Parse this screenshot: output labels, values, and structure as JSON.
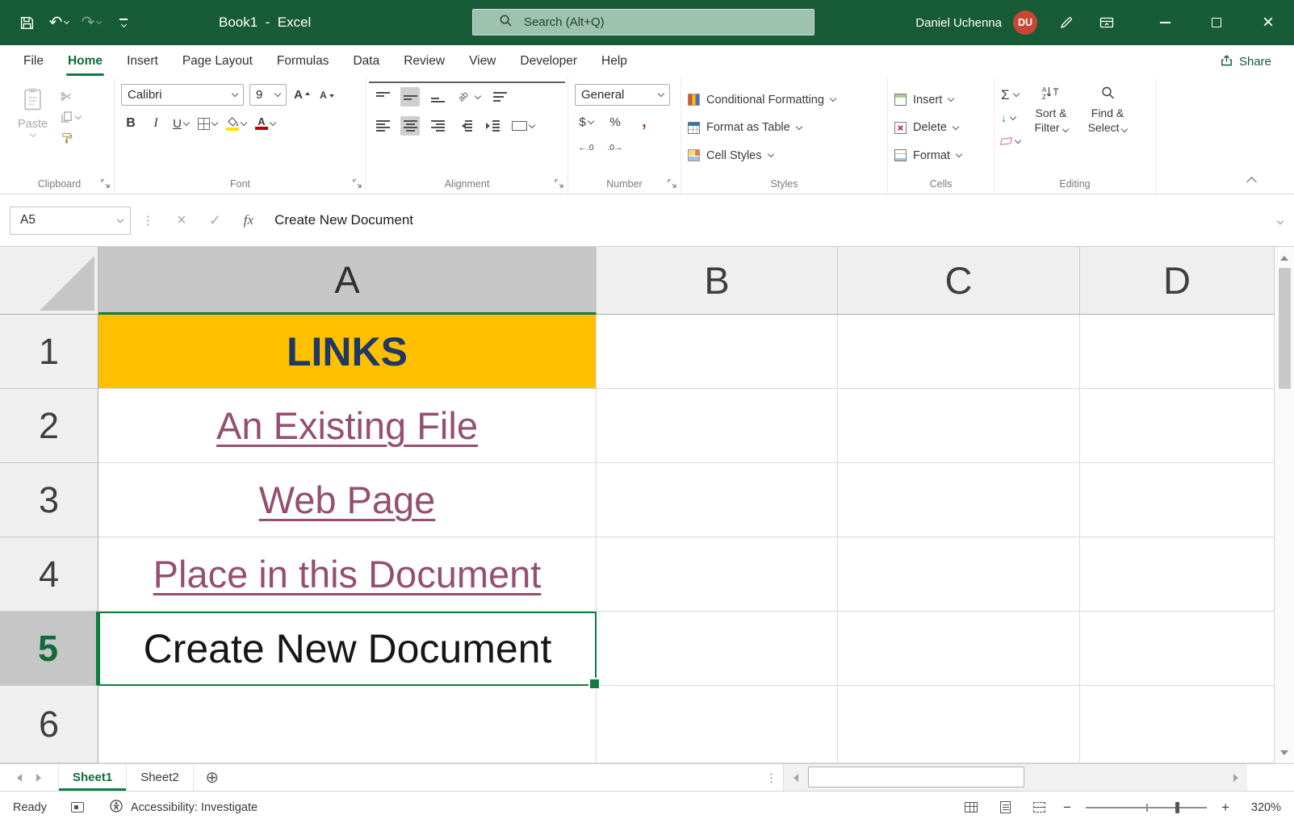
{
  "colors": {
    "titlebar_green": "#185C37",
    "accent_green": "#107C41",
    "link_purple": "#954F72",
    "highlight_yellow": "#FFC000",
    "navy_text": "#1F3864",
    "avatar_orange": "#C74634"
  },
  "titlebar": {
    "app_title": "Book1  -  Excel",
    "search_placeholder": "Search (Alt+Q)",
    "user_name": "Daniel Uchenna",
    "user_initials": "DU"
  },
  "menubar": {
    "tabs": [
      "File",
      "Home",
      "Insert",
      "Page Layout",
      "Formulas",
      "Data",
      "Review",
      "View",
      "Developer",
      "Help"
    ],
    "active_tab": "Home",
    "share_label": "Share"
  },
  "ribbon": {
    "clipboard": {
      "group_label": "Clipboard",
      "paste_label": "Paste"
    },
    "font": {
      "group_label": "Font",
      "font_name": "Calibri",
      "font_size": "9",
      "bold_label": "B",
      "italic_label": "I",
      "underline_label": "U"
    },
    "alignment": {
      "group_label": "Alignment"
    },
    "number": {
      "group_label": "Number",
      "number_format": "General",
      "currency_label": "$",
      "percent_label": "%",
      "comma_label": ","
    },
    "styles": {
      "group_label": "Styles",
      "conditional_formatting": "Conditional Formatting",
      "format_as_table": "Format as Table",
      "cell_styles": "Cell Styles"
    },
    "cells": {
      "group_label": "Cells",
      "insert": "Insert",
      "delete": "Delete",
      "format": "Format"
    },
    "editing": {
      "group_label": "Editing",
      "autosum_label": "Σ",
      "sort_filter": "Sort & Filter",
      "find_select": "Find & Select"
    }
  },
  "formula_bar": {
    "name_box": "A5",
    "fx_label": "fx",
    "formula_text": "Create New Document"
  },
  "grid": {
    "column_headers": [
      "A",
      "B",
      "C",
      "D"
    ],
    "row_headers": [
      "1",
      "2",
      "3",
      "4",
      "5",
      "6"
    ],
    "selected_cell": "A5",
    "cells": [
      {
        "ref": "A1",
        "text": "LINKS",
        "style": "yellow-title"
      },
      {
        "ref": "A2",
        "text": "An Existing File",
        "style": "hyperlink"
      },
      {
        "ref": "A3",
        "text": "Web Page",
        "style": "hyperlink"
      },
      {
        "ref": "A4",
        "text": "Place in this Document",
        "style": "hyperlink"
      },
      {
        "ref": "A5",
        "text": "Create New Document",
        "style": "plain-selected"
      }
    ]
  },
  "sheet_bar": {
    "tabs": [
      "Sheet1",
      "Sheet2"
    ],
    "active_tab": "Sheet1"
  },
  "status_bar": {
    "ready": "Ready",
    "accessibility": "Accessibility: Investigate",
    "zoom_level": "320%"
  }
}
